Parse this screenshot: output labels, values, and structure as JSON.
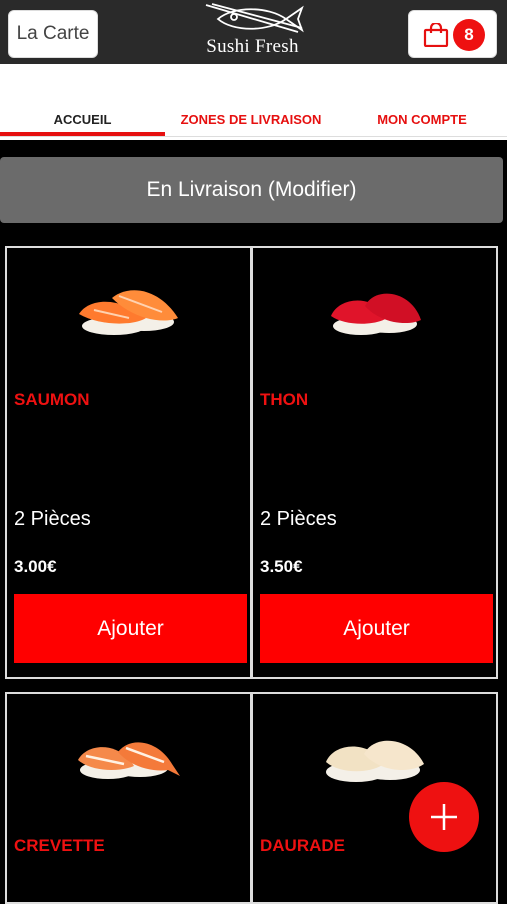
{
  "header": {
    "menu_label": "La Carte",
    "brand": "Sushi Fresh",
    "cart_count": "8"
  },
  "nav": {
    "tabs": [
      {
        "label": "ACCUEIL",
        "active": true
      },
      {
        "label": "ZONES DE LIVRAISON",
        "active": false
      },
      {
        "label": "MON COMPTE",
        "active": false
      }
    ]
  },
  "delivery_label": "En Livraison (Modifier)",
  "products": [
    {
      "name": "SAUMON",
      "pieces": "2 Pièces",
      "price": "3.00€",
      "button": "Ajouter"
    },
    {
      "name": "THON",
      "pieces": "2 Pièces",
      "price": "3.50€",
      "button": "Ajouter"
    },
    {
      "name": "CREVETTE"
    },
    {
      "name": "DAURADE"
    }
  ],
  "colors": {
    "accent": "#ee1111",
    "topbar": "#2a2a2a",
    "delivery_bar": "#6b6b6b"
  },
  "icons": {
    "cart": "shopping-bag-icon",
    "fab": "plus-icon"
  }
}
